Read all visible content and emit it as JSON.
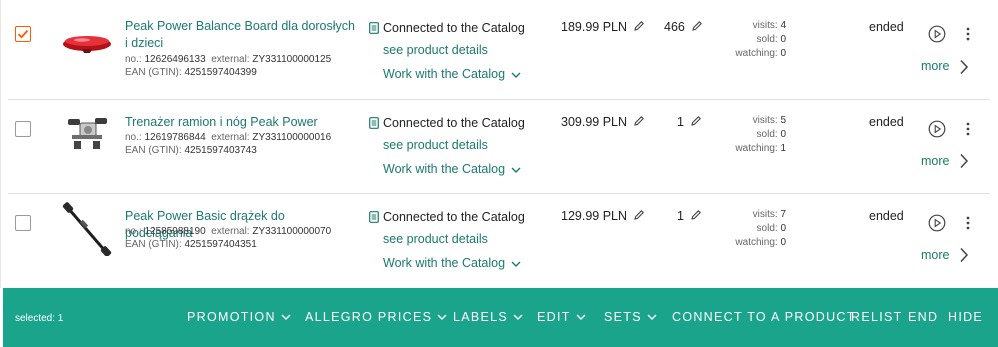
{
  "offers": [
    {
      "checked": true,
      "title": "Peak Power Balance Board dla dorosłych i dzieci",
      "no_label": "no.:",
      "no": "12626496133",
      "external_label": "external:",
      "external": "ZY331100000125",
      "ean_label": "EAN (GTIN):",
      "ean": "4251597404399",
      "catalog_status": "Connected to the Catalog",
      "details_link": "see product details",
      "work_link": "Work with the Catalog",
      "price": "189.99 PLN",
      "quantity": "466",
      "visits_label": "visits:",
      "visits": "4",
      "sold_label": "sold:",
      "sold": "0",
      "watching_label": "watching:",
      "watching": "0",
      "status": "ended",
      "more": "more"
    },
    {
      "checked": false,
      "title": "Trenażer ramion i nóg Peak Power",
      "no_label": "no.:",
      "no": "12619786844",
      "external_label": "external:",
      "external": "ZY331100000016",
      "ean_label": "EAN (GTIN):",
      "ean": "4251597403743",
      "catalog_status": "Connected to the Catalog",
      "details_link": "see product details",
      "work_link": "Work with the Catalog",
      "price": "309.99 PLN",
      "quantity": "1",
      "visits_label": "visits:",
      "visits": "5",
      "sold_label": "sold:",
      "sold": "0",
      "watching_label": "watching:",
      "watching": "1",
      "status": "ended",
      "more": "more"
    },
    {
      "checked": false,
      "title": "Peak Power Basic drążek do podciągania",
      "no_label": "no.:",
      "no": "12585988190",
      "external_label": "external:",
      "external": "ZY331100000070",
      "ean_label": "EAN (GTIN):",
      "ean": "4251597404351",
      "catalog_status": "Connected to the Catalog",
      "details_link": "see product details",
      "work_link": "Work with the Catalog",
      "price": "129.99 PLN",
      "quantity": "1",
      "visits_label": "visits:",
      "visits": "7",
      "sold_label": "sold:",
      "sold": "0",
      "watching_label": "watching:",
      "watching": "0",
      "status": "ended",
      "more": "more"
    }
  ],
  "bulk_bar": {
    "selected": "selected: 1",
    "promotion": "PROMOTION",
    "allegro_prices": "ALLEGRO PRICES",
    "labels": "LABELS",
    "edit": "EDIT",
    "sets": "SETS",
    "connect": "CONNECT TO A PRODUCT",
    "relist": "RELIST",
    "end": "END",
    "hide": "HIDE"
  },
  "colors": {
    "accent_teal": "#1b7a6e",
    "bar_green": "#1ba48c",
    "checkbox_checked": "#ff5a00"
  },
  "icons": [
    "checkmark-icon",
    "document-icon",
    "chevron-down-icon",
    "pencil-icon",
    "play-icon",
    "kebab-icon",
    "chevron-right-icon"
  ]
}
